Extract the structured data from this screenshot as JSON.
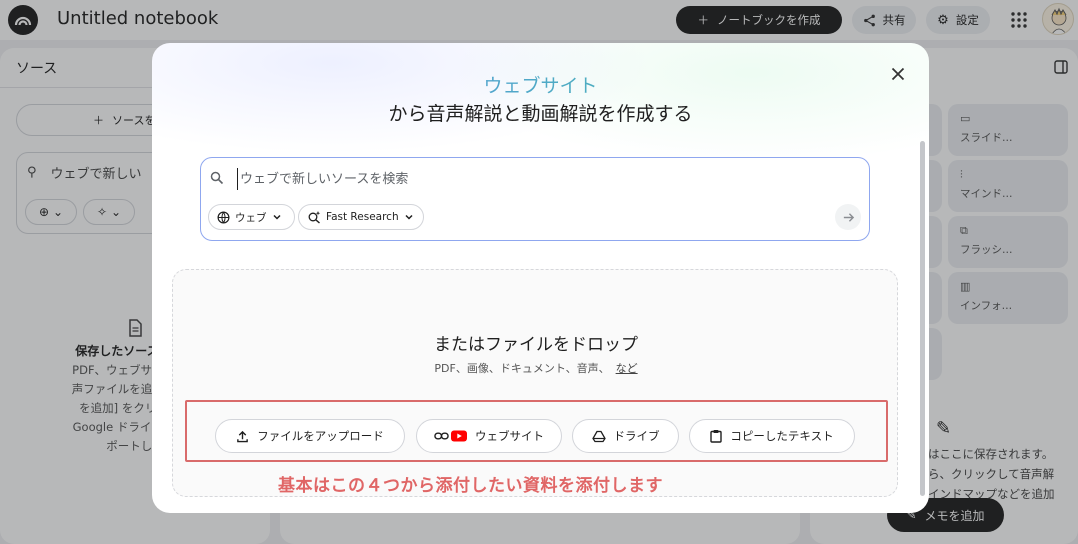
{
  "app": {
    "notebook_title": "Untitled notebook",
    "create_button": "ノートブックを作成",
    "share_button": "共有",
    "settings_button": "設定"
  },
  "sources_panel": {
    "title": "ソース",
    "add_source": "ソースを",
    "search_text": "ウェブで新しい",
    "empty_title": "保存したソースがここ",
    "empty_lines": [
      "PDF、ウェブサイト、テ",
      "声ファイルを追加するに",
      "を追加] をクリックし",
      "Google ドライブからフ",
      "ポートしま"
    ]
  },
  "studio_panel": {
    "tiles": [
      "スライド…",
      "マインド…",
      "フラッシ…",
      "インフォ…"
    ],
    "note_lines": [
      "はここに保存されます。",
      "ら、クリックして音声解",
      "インドマップなどを追加"
    ],
    "add_memo_button": "メモを追加"
  },
  "modal": {
    "title_accent": "ウェブサイト",
    "title": "から音声解説と動画解説を作成する",
    "search": {
      "placeholder": "ウェブで新しいソースを検索",
      "web_chip": "ウェブ",
      "research_chip": "Fast Research"
    },
    "drop": {
      "title": "またはファイルをドロップ",
      "subtitle": "PDF、画像、ドキュメント、音声、",
      "subtitle_link": "など"
    },
    "actions": {
      "upload": "ファイルをアップロード",
      "website": "ウェブサイト",
      "drive": "ドライブ",
      "paste": "コピーしたテキスト"
    },
    "annotation": "基本はこの４つから添付したい資料を添付します"
  },
  "colors": {
    "highlight": "#d96b6b",
    "annotation_text": "#e06666",
    "search_border": "#8fa7ef",
    "accent_gradient_start": "#5b8def",
    "accent_gradient_end": "#43c59e",
    "youtube_red": "#ff0000"
  },
  "icons": [
    "notebooklm-logo-icon",
    "plus-icon",
    "share-icon",
    "gear-icon",
    "apps-grid-icon",
    "close-icon",
    "search-icon",
    "globe-icon",
    "chevron-down-icon",
    "sparkle-search-icon",
    "arrow-right-icon",
    "upload-icon",
    "link-icon",
    "youtube-icon",
    "drive-icon",
    "clipboard-icon",
    "document-icon",
    "wand-icon",
    "panel-toggle-icon"
  ]
}
